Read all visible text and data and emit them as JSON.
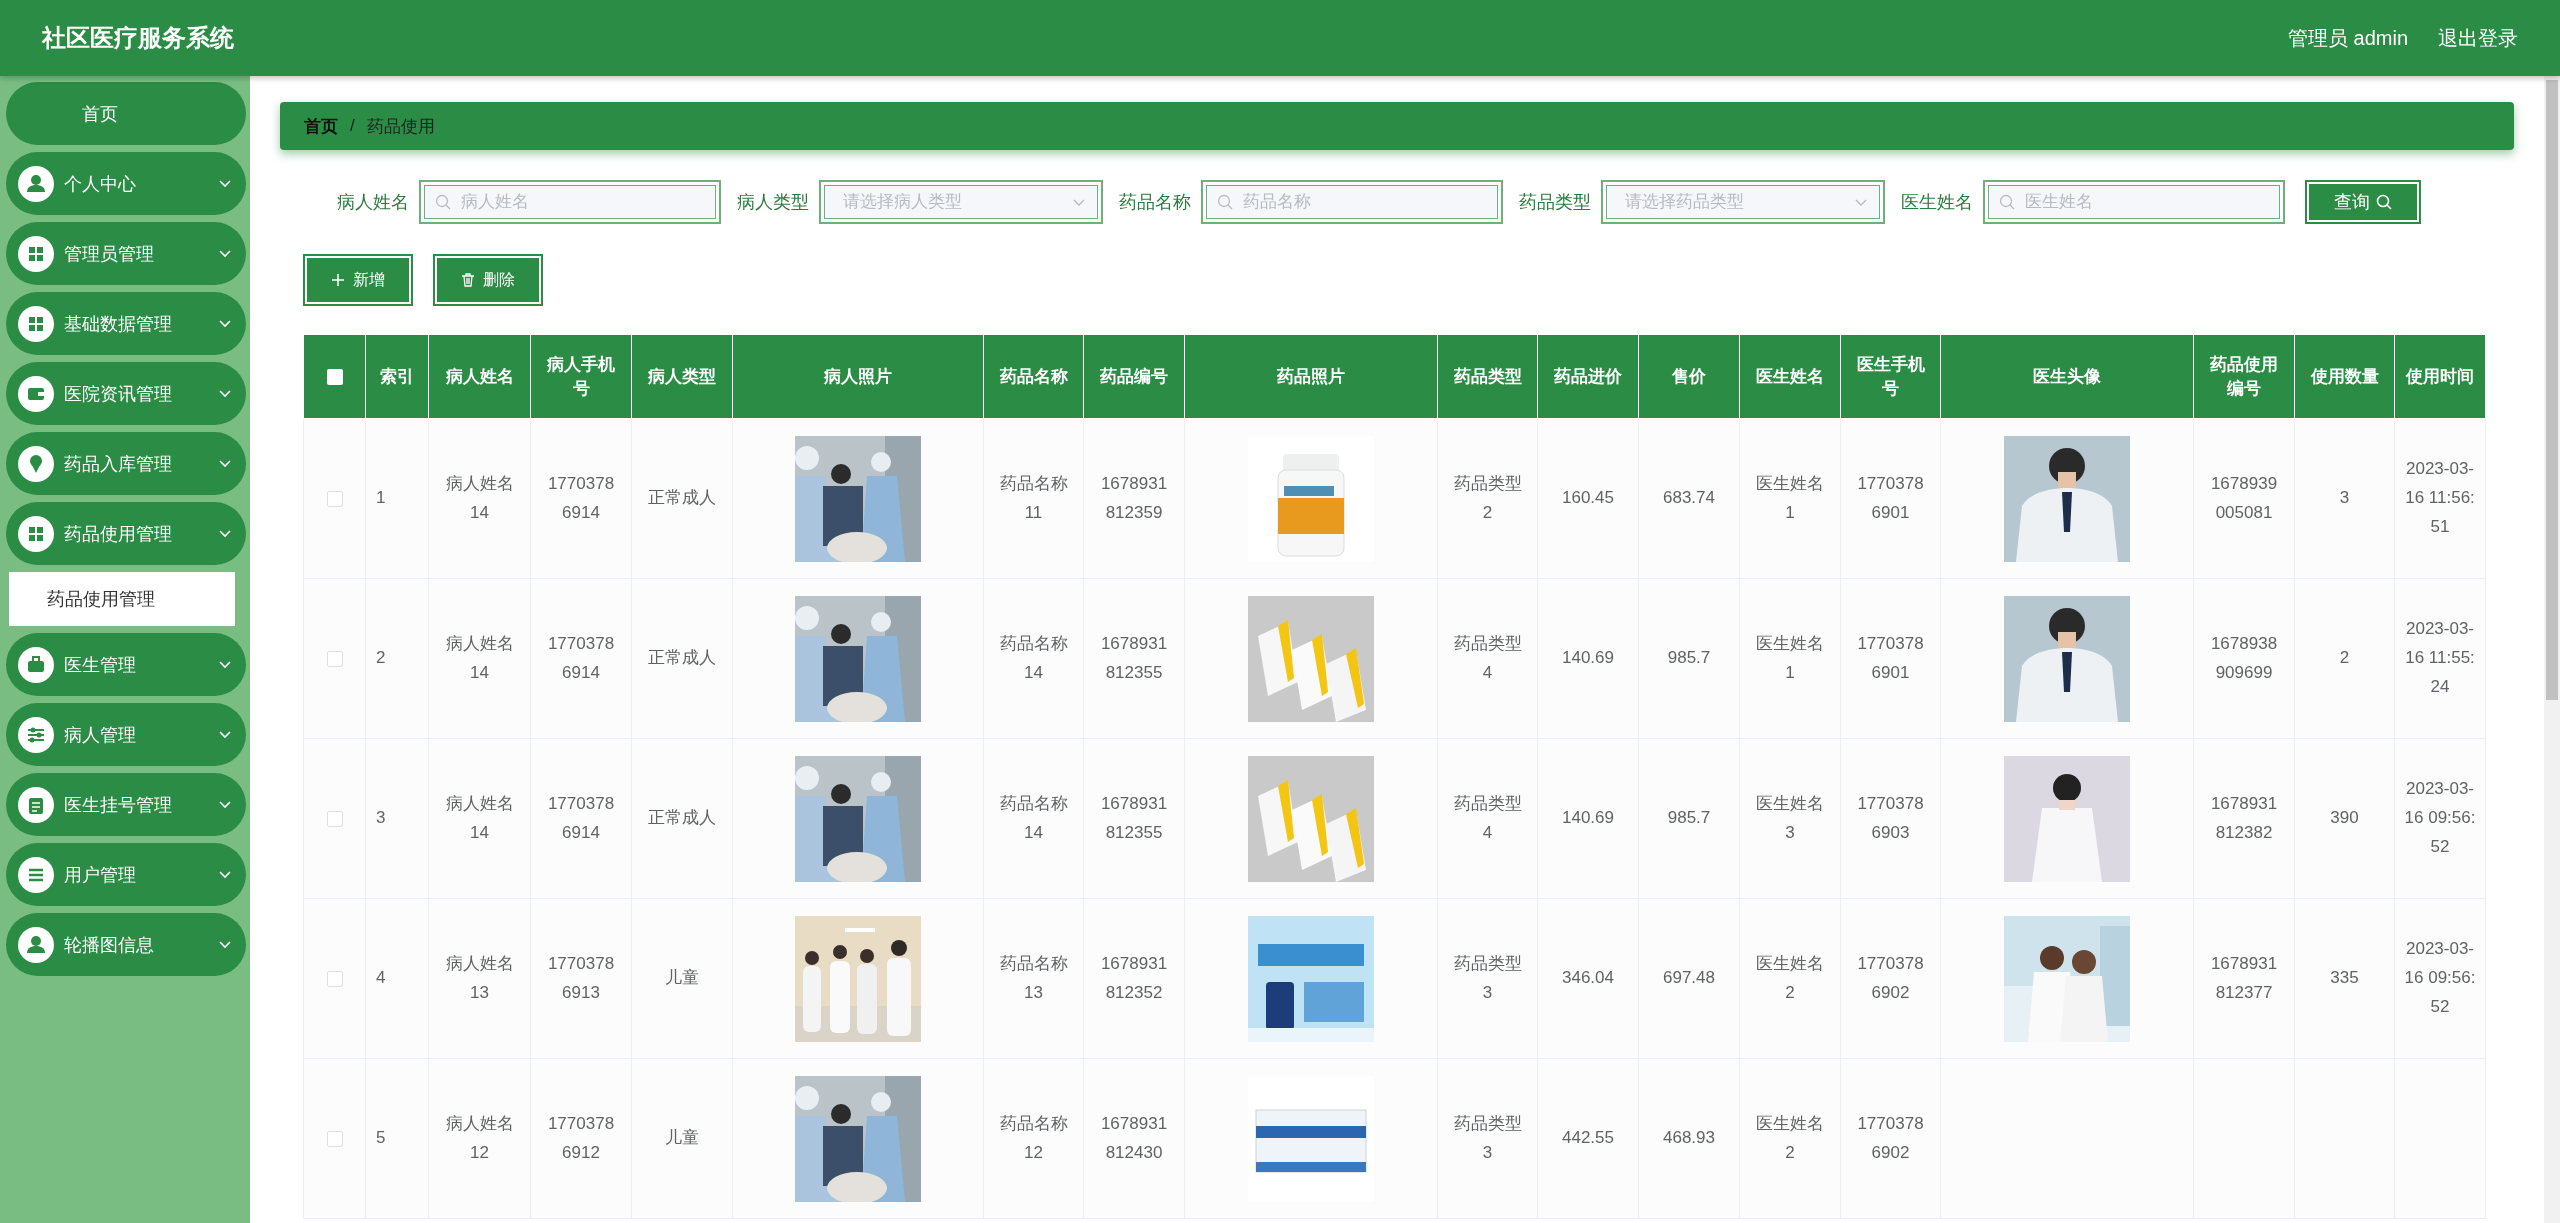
{
  "header": {
    "title": "社区医疗服务系统",
    "user": "管理员 admin",
    "logout": "退出登录"
  },
  "sidebar": {
    "items": [
      {
        "label": "首页",
        "kind": "link"
      },
      {
        "label": "个人中心",
        "kind": "menu"
      },
      {
        "label": "管理员管理",
        "kind": "menu"
      },
      {
        "label": "基础数据管理",
        "kind": "menu"
      },
      {
        "label": "医院资讯管理",
        "kind": "menu"
      },
      {
        "label": "药品入库管理",
        "kind": "menu"
      },
      {
        "label": "药品使用管理",
        "kind": "menu",
        "children": [
          {
            "label": "药品使用管理",
            "selected": true
          }
        ]
      },
      {
        "label": "医生管理",
        "kind": "menu"
      },
      {
        "label": "病人管理",
        "kind": "menu"
      },
      {
        "label": "医生挂号管理",
        "kind": "menu"
      },
      {
        "label": "用户管理",
        "kind": "menu"
      },
      {
        "label": "轮播图信息",
        "kind": "menu"
      }
    ]
  },
  "breadcrumb": {
    "items": [
      "首页",
      "药品使用"
    ],
    "separator": "/"
  },
  "filters": [
    {
      "label": "病人姓名",
      "kind": "text",
      "placeholder": "病人姓名"
    },
    {
      "label": "病人类型",
      "kind": "select",
      "placeholder": "请选择病人类型"
    },
    {
      "label": "药品名称",
      "kind": "text",
      "placeholder": "药品名称"
    },
    {
      "label": "药品类型",
      "kind": "select",
      "placeholder": "请选择药品类型"
    },
    {
      "label": "医生姓名",
      "kind": "text",
      "placeholder": "医生姓名"
    }
  ],
  "query_button": "查询",
  "actions": [
    {
      "label": "新增",
      "kind": "add"
    },
    {
      "label": "删除",
      "kind": "delete"
    }
  ],
  "table": {
    "all_checked": false,
    "columns": [
      {
        "label": "索引",
        "kind": "text"
      },
      {
        "label": "病人姓名",
        "kind": "text"
      },
      {
        "label": "病人手机号",
        "kind": "text"
      },
      {
        "label": "病人类型",
        "kind": "text"
      },
      {
        "label": "病人照片",
        "kind": "picture"
      },
      {
        "label": "药品名称",
        "kind": "text"
      },
      {
        "label": "药品编号",
        "kind": "text"
      },
      {
        "label": "药品照片",
        "kind": "picture"
      },
      {
        "label": "药品类型",
        "kind": "text"
      },
      {
        "label": "药品进价",
        "kind": "text"
      },
      {
        "label": "售价",
        "kind": "text"
      },
      {
        "label": "医生姓名",
        "kind": "text"
      },
      {
        "label": "医生手机号",
        "kind": "text"
      },
      {
        "label": "医生头像",
        "kind": "picture"
      },
      {
        "label": "药品使用编号",
        "kind": "text"
      },
      {
        "label": "使用数量",
        "kind": "text"
      },
      {
        "label": "使用时间",
        "kind": "text"
      }
    ],
    "rows": [
      {
        "checked": false,
        "cells": [
          "1",
          "病人姓名14",
          "17703786914",
          "正常成人",
          {
            "kind": "picture"
          },
          "药品名称11",
          "1678931812359",
          {
            "kind": "picture"
          },
          "药品类型2",
          "160.45",
          "683.74",
          "医生姓名1",
          "17703786901",
          {
            "kind": "picture"
          },
          "1678939005081",
          "3",
          "2023-03-16 11:56:51"
        ]
      },
      {
        "checked": false,
        "cells": [
          "2",
          "病人姓名14",
          "17703786914",
          "正常成人",
          {
            "kind": "picture"
          },
          "药品名称14",
          "1678931812355",
          {
            "kind": "picture"
          },
          "药品类型4",
          "140.69",
          "985.7",
          "医生姓名1",
          "17703786901",
          {
            "kind": "picture"
          },
          "1678938909699",
          "2",
          "2023-03-16 11:55:24"
        ]
      },
      {
        "checked": false,
        "cells": [
          "3",
          "病人姓名14",
          "17703786914",
          "正常成人",
          {
            "kind": "picture"
          },
          "药品名称14",
          "1678931812355",
          {
            "kind": "picture"
          },
          "药品类型4",
          "140.69",
          "985.7",
          "医生姓名3",
          "17703786903",
          {
            "kind": "picture"
          },
          "1678931812382",
          "390",
          "2023-03-16 09:56:52"
        ]
      },
      {
        "checked": false,
        "cells": [
          "4",
          "病人姓名13",
          "17703786913",
          "儿童",
          {
            "kind": "picture"
          },
          "药品名称13",
          "1678931812352",
          {
            "kind": "picture"
          },
          "药品类型3",
          "346.04",
          "697.48",
          "医生姓名2",
          "17703786902",
          {
            "kind": "picture"
          },
          "1678931812377",
          "335",
          "2023-03-16 09:56:52"
        ]
      },
      {
        "checked": false,
        "cells": [
          "5",
          "病人姓名12",
          "17703786912",
          "儿童",
          {
            "kind": "picture"
          },
          "药品名称12",
          "1678931812430",
          {
            "kind": "picture"
          },
          "药品类型3",
          "442.55",
          "468.93",
          "医生姓名2",
          "17703786902"
        ]
      }
    ]
  }
}
